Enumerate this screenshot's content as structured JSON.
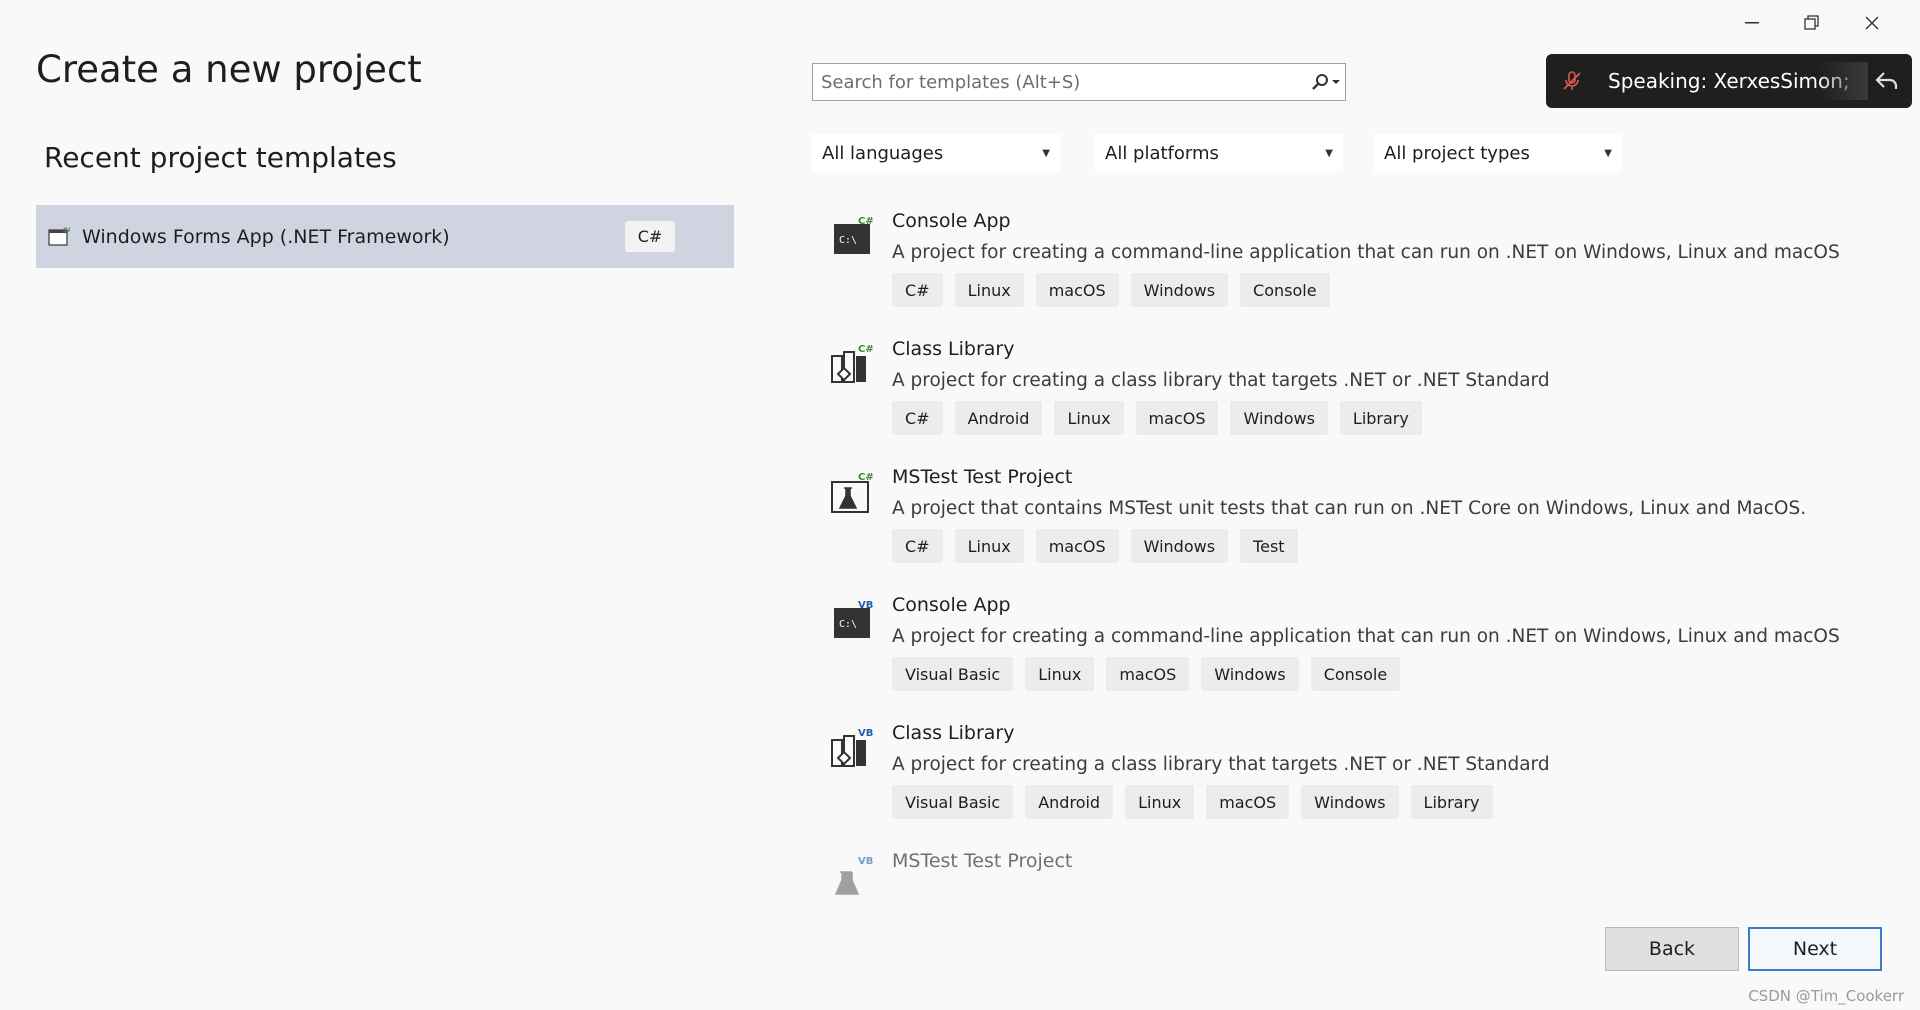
{
  "window": {
    "minimize_glyph": "—",
    "restore_glyph": "❐",
    "close_glyph": "✕"
  },
  "left": {
    "title": "Create a new project",
    "recent_heading": "Recent project templates",
    "recent_items": [
      {
        "label": "Windows Forms App (.NET Framework)",
        "badge": "C#",
        "icon": "winforms-icon"
      }
    ]
  },
  "search": {
    "placeholder": "Search for templates (Alt+S)",
    "value": ""
  },
  "notification": {
    "text": "Speaking: XerxesSimon;",
    "icons": [
      "mic-muted-icon",
      "back-arrow-icon"
    ]
  },
  "filters": [
    {
      "label": "All languages"
    },
    {
      "label": "All platforms"
    },
    {
      "label": "All project types"
    }
  ],
  "templates": [
    {
      "name": "Console App",
      "lang_badge": "C#",
      "icon": "console-icon",
      "description": "A project for creating a command-line application that can run on .NET on Windows, Linux and macOS",
      "tags": [
        "C#",
        "Linux",
        "macOS",
        "Windows",
        "Console"
      ]
    },
    {
      "name": "Class Library",
      "lang_badge": "C#",
      "icon": "class-library-icon",
      "description": "A project for creating a class library that targets .NET or .NET Standard",
      "tags": [
        "C#",
        "Android",
        "Linux",
        "macOS",
        "Windows",
        "Library"
      ]
    },
    {
      "name": "MSTest Test Project",
      "lang_badge": "C#",
      "icon": "test-flask-icon",
      "description": "A project that contains MSTest unit tests that can run on .NET Core on Windows, Linux and MacOS.",
      "tags": [
        "C#",
        "Linux",
        "macOS",
        "Windows",
        "Test"
      ]
    },
    {
      "name": "Console App",
      "lang_badge": "VB",
      "icon": "console-icon",
      "description": "A project for creating a command-line application that can run on .NET on Windows, Linux and macOS",
      "tags": [
        "Visual Basic",
        "Linux",
        "macOS",
        "Windows",
        "Console"
      ]
    },
    {
      "name": "Class Library",
      "lang_badge": "VB",
      "icon": "class-library-icon",
      "description": "A project for creating a class library that targets .NET or .NET Standard",
      "tags": [
        "Visual Basic",
        "Android",
        "Linux",
        "macOS",
        "Windows",
        "Library"
      ]
    },
    {
      "name": "MSTest Test Project",
      "lang_badge": "VB",
      "icon": "test-flask-icon",
      "description": "",
      "tags": []
    }
  ],
  "buttons": {
    "back": "Back",
    "next": "Next"
  },
  "watermark": "CSDN @Tim_Cookerr",
  "colors": {
    "background": "#f9f9f9",
    "selected_recent": "#d0d4e0",
    "csharp_badge": "#388a34",
    "vb_badge": "#1f5fa8",
    "primary_button_border": "#3b7bc8",
    "notification_bg": "#1f1f1f"
  }
}
